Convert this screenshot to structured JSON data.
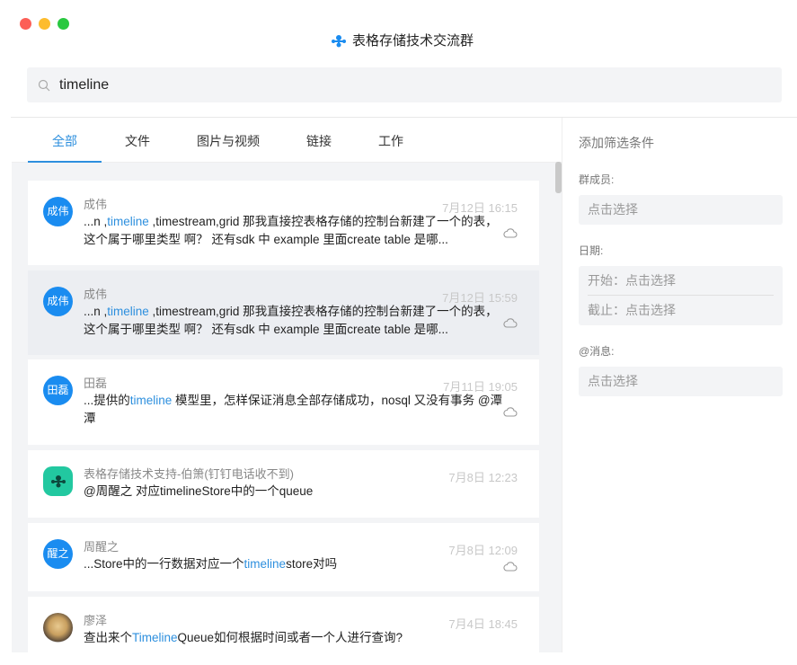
{
  "window": {
    "title": "表格存储技术交流群"
  },
  "search": {
    "value": "timeline"
  },
  "tabs": [
    "全部",
    "文件",
    "图片与视频",
    "链接",
    "工作"
  ],
  "messages": [
    {
      "avatar": "成伟",
      "name": "成伟",
      "time": "7月12日 16:15",
      "pre": "...n ,",
      "hl": "timeline",
      "post": " ,timestream,grid 那我直接控表格存储的控制台新建了一个的表，这个属于哪里类型 啊？ 还有sdk 中 example 里面create table 是哪...",
      "cloud": true
    },
    {
      "avatar": "成伟",
      "name": "成伟",
      "time": "7月12日 15:59",
      "pre": "...n ,",
      "hl": "timeline",
      "post": " ,timestream,grid 那我直接控表格存储的控制台新建了一个的表，这个属于哪里类型 啊？ 还有sdk 中 example 里面create table 是哪...",
      "cloud": true
    },
    {
      "avatar": "田磊",
      "name": "田磊",
      "time": "7月11日 19:05",
      "pre": "...提供的",
      "hl": "timeline",
      "post": " 模型里，怎样保证消息全部存储成功，nosql 又没有事务 @潭潭",
      "cloud": true
    },
    {
      "avatar": "",
      "name": "表格存储技术支持-伯箫(钉钉电话收不到)",
      "time": "7月8日 12:23",
      "pre": "@周醒之 对应timelineStore中的一个queue",
      "hl": "",
      "post": "",
      "cloud": false
    },
    {
      "avatar": "醒之",
      "name": "周醒之",
      "time": "7月8日 12:09",
      "pre": "...Store中的一行数据对应一个",
      "hl": "timeline",
      "post": "store对吗",
      "cloud": true
    },
    {
      "avatar": "",
      "name": "廖泽",
      "time": "7月4日 18:45",
      "pre": "查出来个",
      "hl": "Timeline",
      "post": "Queue如何根据时间或者一个人进行查询?",
      "cloud": false
    }
  ],
  "filters": {
    "heading": "添加筛选条件",
    "member_label": "群成员:",
    "member_value": "点击选择",
    "date_label": "日期:",
    "date_start": "开始：点击选择",
    "date_end": "截止：点击选择",
    "at_label": "@消息:",
    "at_value": "点击选择"
  }
}
